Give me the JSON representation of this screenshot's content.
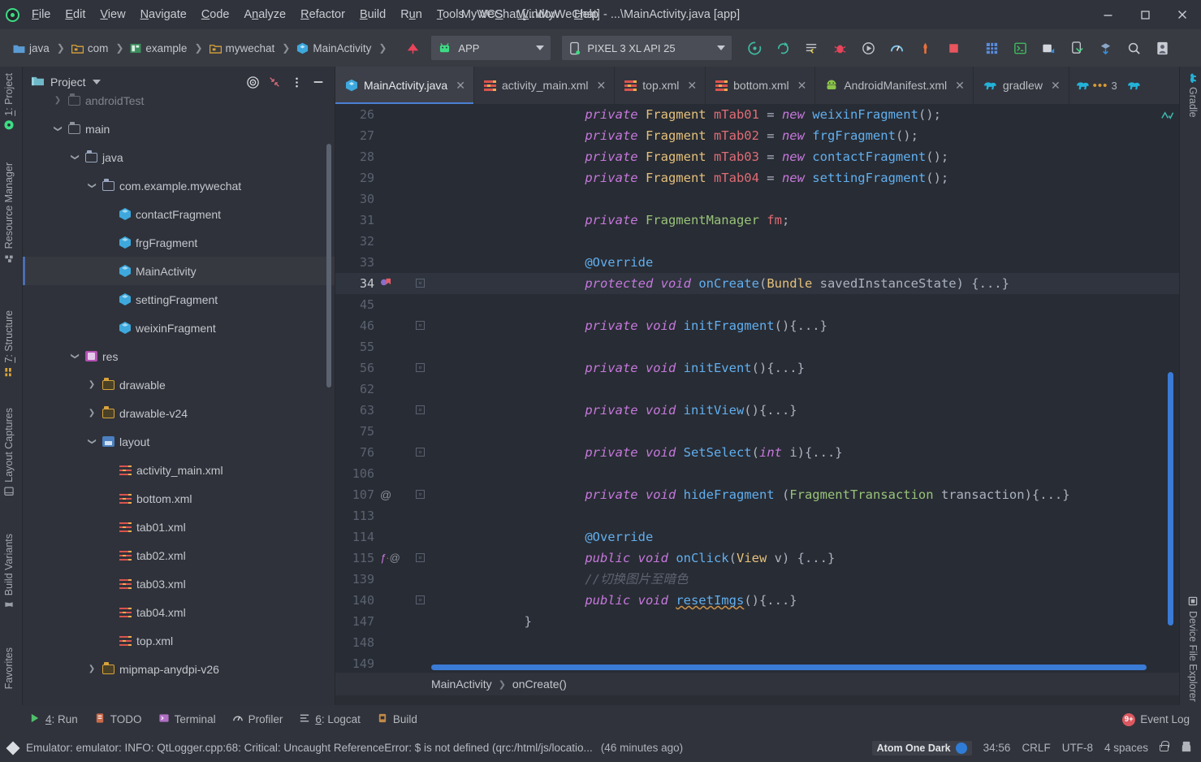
{
  "window": {
    "title": "MyWeChat [...\\MyWeChat] - ...\\MainActivity.java [app]",
    "minimize": "—",
    "maximize": "☐",
    "close": "✕"
  },
  "menu": {
    "items": [
      "File",
      "Edit",
      "View",
      "Navigate",
      "Code",
      "Analyze",
      "Refactor",
      "Build",
      "Run",
      "Tools",
      "VCS",
      "Window",
      "Help"
    ]
  },
  "navbar": {
    "breadcrumbs": [
      {
        "label": "java",
        "icon": "folder-blue-icon"
      },
      {
        "label": "com",
        "icon": "folder-yellow-icon"
      },
      {
        "label": "example",
        "icon": "module-green-icon"
      },
      {
        "label": "mywechat",
        "icon": "folder-yellow-icon"
      },
      {
        "label": "MainActivity",
        "icon": "java-class-icon"
      }
    ],
    "run_config": "APP",
    "device": "PIXEL 3 XL API 25",
    "toolbuttons": [
      "run-icon",
      "debug-rerun-icon",
      "apply-changes-icon",
      "debug-bug-icon",
      "run-with-coverage-icon",
      "profiler-icon",
      "attach-debugger-icon",
      "stop-icon",
      "layout-inspector-icon",
      "terminal-icon",
      "avd-manager-icon",
      "sdk-device-icon",
      "sdk-manager-icon",
      "search-icon",
      "user-avatar-icon"
    ]
  },
  "left_strip": {
    "items": [
      {
        "label": "1: Project",
        "mnemonic": "1",
        "icon": "project-icon"
      },
      {
        "label": "Resource Manager",
        "icon": "resource-manager-icon"
      },
      {
        "label": "7: Structure",
        "mnemonic": "7",
        "icon": "structure-icon"
      },
      {
        "label": "Layout Captures",
        "icon": "layout-captures-icon"
      },
      {
        "label": "Build Variants",
        "icon": "build-variants-icon"
      },
      {
        "label": "Favorites",
        "icon": "favorites-icon"
      }
    ]
  },
  "right_strip": {
    "items": [
      {
        "label": "Gradle",
        "icon": "gradle-elephant-icon"
      },
      {
        "label": "Device File Explorer",
        "icon": "device-file-explorer-icon"
      }
    ]
  },
  "project_panel": {
    "title": "Project",
    "actions": [
      "target-locate-icon",
      "collapse-all-icon",
      "options-menu-icon",
      "hide-icon"
    ],
    "tree": [
      {
        "label": "androidTest",
        "depth": 1,
        "state": "collapsed",
        "icon": "folder-grey-icon",
        "selected": false,
        "dim": true
      },
      {
        "label": "main",
        "depth": 1,
        "state": "expanded",
        "icon": "folder-grey-icon",
        "selected": false
      },
      {
        "label": "java",
        "depth": 2,
        "state": "expanded",
        "icon": "folder-blue-icon",
        "selected": false
      },
      {
        "label": "com.example.mywechat",
        "depth": 3,
        "state": "expanded",
        "icon": "folder-blue-icon",
        "selected": false
      },
      {
        "label": "contactFragment",
        "depth": 4,
        "state": "leaf",
        "icon": "java-class-icon",
        "selected": false
      },
      {
        "label": "frgFragment",
        "depth": 4,
        "state": "leaf",
        "icon": "java-class-icon",
        "selected": false
      },
      {
        "label": "MainActivity",
        "depth": 4,
        "state": "leaf",
        "icon": "java-class-icon",
        "selected": true
      },
      {
        "label": "settingFragment",
        "depth": 4,
        "state": "leaf",
        "icon": "java-class-icon",
        "selected": false
      },
      {
        "label": "weixinFragment",
        "depth": 4,
        "state": "leaf",
        "icon": "java-class-icon",
        "selected": false
      },
      {
        "label": "res",
        "depth": 2,
        "state": "expanded",
        "icon": "res-folder-icon",
        "selected": false
      },
      {
        "label": "drawable",
        "depth": 3,
        "state": "collapsed",
        "icon": "folder-yellow-icon",
        "selected": false
      },
      {
        "label": "drawable-v24",
        "depth": 3,
        "state": "collapsed",
        "icon": "folder-yellow-icon",
        "selected": false
      },
      {
        "label": "layout",
        "depth": 3,
        "state": "expanded",
        "icon": "layout-folder-icon",
        "selected": false
      },
      {
        "label": "activity_main.xml",
        "depth": 4,
        "state": "leaf",
        "icon": "xml-layout-icon",
        "selected": false
      },
      {
        "label": "bottom.xml",
        "depth": 4,
        "state": "leaf",
        "icon": "xml-layout-icon",
        "selected": false
      },
      {
        "label": "tab01.xml",
        "depth": 4,
        "state": "leaf",
        "icon": "xml-layout-icon",
        "selected": false
      },
      {
        "label": "tab02.xml",
        "depth": 4,
        "state": "leaf",
        "icon": "xml-layout-icon",
        "selected": false
      },
      {
        "label": "tab03.xml",
        "depth": 4,
        "state": "leaf",
        "icon": "xml-layout-icon",
        "selected": false
      },
      {
        "label": "tab04.xml",
        "depth": 4,
        "state": "leaf",
        "icon": "xml-layout-icon",
        "selected": false
      },
      {
        "label": "top.xml",
        "depth": 4,
        "state": "leaf",
        "icon": "xml-layout-icon",
        "selected": false
      },
      {
        "label": "mipmap-anydpi-v26",
        "depth": 3,
        "state": "collapsed",
        "icon": "folder-yellow-icon",
        "selected": false
      }
    ]
  },
  "editor_tabs": {
    "tabs": [
      {
        "label": "MainActivity.java",
        "icon": "java-class-icon",
        "active": true,
        "close": "✕"
      },
      {
        "label": "activity_main.xml",
        "icon": "xml-layout-icon",
        "active": false,
        "close": "✕"
      },
      {
        "label": "top.xml",
        "icon": "xml-layout-icon",
        "active": false,
        "close": "✕"
      },
      {
        "label": "bottom.xml",
        "icon": "xml-layout-icon",
        "active": false,
        "close": "✕"
      },
      {
        "label": "AndroidManifest.xml",
        "icon": "android-robot-icon",
        "active": false,
        "close": "✕"
      },
      {
        "label": "gradlew",
        "icon": "gradle-elephant-icon",
        "active": false,
        "close": "✕"
      }
    ],
    "overflow_count": "3",
    "overflow_icon": "more-tabs-icon"
  },
  "editor": {
    "current_line": 34,
    "lines": [
      {
        "num": "26",
        "indent": 2,
        "tokens": [
          {
            "t": "private ",
            "c": "kw"
          },
          {
            "t": "Fragment",
            "c": "typ"
          },
          {
            "t": " mTab01 ",
            "c": "var"
          },
          {
            "t": "= ",
            "c": "op"
          },
          {
            "t": "new ",
            "c": "kw"
          },
          {
            "t": "weixinFragment",
            "c": "fn"
          },
          {
            "t": "();",
            "c": "pl"
          }
        ]
      },
      {
        "num": "27",
        "indent": 2,
        "tokens": [
          {
            "t": "private ",
            "c": "kw"
          },
          {
            "t": "Fragment",
            "c": "typ"
          },
          {
            "t": " mTab02 ",
            "c": "var"
          },
          {
            "t": "= ",
            "c": "op"
          },
          {
            "t": "new ",
            "c": "kw"
          },
          {
            "t": "frgFragment",
            "c": "fn"
          },
          {
            "t": "();",
            "c": "pl"
          }
        ]
      },
      {
        "num": "28",
        "indent": 2,
        "tokens": [
          {
            "t": "private ",
            "c": "kw"
          },
          {
            "t": "Fragment",
            "c": "typ"
          },
          {
            "t": " mTab03 ",
            "c": "var"
          },
          {
            "t": "= ",
            "c": "op"
          },
          {
            "t": "new ",
            "c": "kw"
          },
          {
            "t": "contactFragment",
            "c": "fn"
          },
          {
            "t": "();",
            "c": "pl"
          }
        ]
      },
      {
        "num": "29",
        "indent": 2,
        "tokens": [
          {
            "t": "private ",
            "c": "kw"
          },
          {
            "t": "Fragment",
            "c": "typ"
          },
          {
            "t": " mTab04 ",
            "c": "var"
          },
          {
            "t": "= ",
            "c": "op"
          },
          {
            "t": "new ",
            "c": "kw"
          },
          {
            "t": "settingFragment",
            "c": "fn"
          },
          {
            "t": "();",
            "c": "pl"
          }
        ]
      },
      {
        "num": "30",
        "indent": 0,
        "tokens": []
      },
      {
        "num": "31",
        "indent": 2,
        "tokens": [
          {
            "t": "private ",
            "c": "kw"
          },
          {
            "t": "FragmentManager",
            "c": "fld"
          },
          {
            "t": " fm",
            "c": "var"
          },
          {
            "t": ";",
            "c": "pl"
          }
        ]
      },
      {
        "num": "32",
        "indent": 0,
        "tokens": []
      },
      {
        "num": "33",
        "indent": 2,
        "tokens": [
          {
            "t": "@Override",
            "c": "ann"
          }
        ]
      },
      {
        "num": "34",
        "indent": 2,
        "gutter": "breakpoint-bookmark-icon",
        "fold": true,
        "current": true,
        "tokens": [
          {
            "t": "protected ",
            "c": "kw"
          },
          {
            "t": "void ",
            "c": "kw"
          },
          {
            "t": "onCreate",
            "c": "fn"
          },
          {
            "t": "(",
            "c": "pl"
          },
          {
            "t": "Bundle",
            "c": "typ"
          },
          {
            "t": " savedInstanceState",
            "c": "pl"
          },
          {
            "t": ") {...}",
            "c": "pl"
          }
        ]
      },
      {
        "num": "45",
        "indent": 0,
        "tokens": []
      },
      {
        "num": "46",
        "indent": 2,
        "fold": true,
        "tokens": [
          {
            "t": "private ",
            "c": "kw"
          },
          {
            "t": "void ",
            "c": "kw"
          },
          {
            "t": "initFragment",
            "c": "fn"
          },
          {
            "t": "(){...}",
            "c": "pl"
          }
        ]
      },
      {
        "num": "55",
        "indent": 0,
        "tokens": []
      },
      {
        "num": "56",
        "indent": 2,
        "fold": true,
        "tokens": [
          {
            "t": "private ",
            "c": "kw"
          },
          {
            "t": "void ",
            "c": "kw"
          },
          {
            "t": "initEvent",
            "c": "fn"
          },
          {
            "t": "(){...}",
            "c": "pl"
          }
        ]
      },
      {
        "num": "62",
        "indent": 0,
        "tokens": []
      },
      {
        "num": "63",
        "indent": 2,
        "fold": true,
        "tokens": [
          {
            "t": "private ",
            "c": "kw"
          },
          {
            "t": "void ",
            "c": "kw"
          },
          {
            "t": "initView",
            "c": "fn"
          },
          {
            "t": "(){...}",
            "c": "pl"
          }
        ]
      },
      {
        "num": "75",
        "indent": 0,
        "tokens": []
      },
      {
        "num": "76",
        "indent": 2,
        "fold": true,
        "tokens": [
          {
            "t": "private ",
            "c": "kw"
          },
          {
            "t": "void ",
            "c": "kw"
          },
          {
            "t": "SetSelect",
            "c": "fn"
          },
          {
            "t": "(",
            "c": "pl"
          },
          {
            "t": "int ",
            "c": "kw"
          },
          {
            "t": "i){...}",
            "c": "pl"
          }
        ]
      },
      {
        "num": "106",
        "indent": 0,
        "tokens": []
      },
      {
        "num": "107",
        "indent": 2,
        "gutter": "override-marker-icon",
        "fold": true,
        "tokens": [
          {
            "t": "private ",
            "c": "kw"
          },
          {
            "t": "void ",
            "c": "kw"
          },
          {
            "t": "hideFragment",
            "c": "fn"
          },
          {
            "t": " (",
            "c": "pl"
          },
          {
            "t": "FragmentTransaction",
            "c": "fld"
          },
          {
            "t": " transaction",
            "c": "pl"
          },
          {
            "t": "){...}",
            "c": "pl"
          }
        ]
      },
      {
        "num": "113",
        "indent": 0,
        "tokens": []
      },
      {
        "num": "114",
        "indent": 2,
        "tokens": [
          {
            "t": "@Override",
            "c": "ann"
          }
        ]
      },
      {
        "num": "115",
        "indent": 2,
        "gutter": "implements-override-icon",
        "fold": true,
        "tokens": [
          {
            "t": "public ",
            "c": "kw"
          },
          {
            "t": "void ",
            "c": "kw"
          },
          {
            "t": "onClick",
            "c": "fn"
          },
          {
            "t": "(",
            "c": "pl"
          },
          {
            "t": "View",
            "c": "typ"
          },
          {
            "t": " v) {...}",
            "c": "pl"
          }
        ]
      },
      {
        "num": "139",
        "indent": 2,
        "tokens": [
          {
            "t": "//切换图片至暗色",
            "c": "cm"
          }
        ]
      },
      {
        "num": "140",
        "indent": 2,
        "fold": true,
        "tokens": [
          {
            "t": "public ",
            "c": "kw"
          },
          {
            "t": "void ",
            "c": "kw"
          },
          {
            "t": "resetImgs",
            "c": "fn squig"
          },
          {
            "t": "(){...}",
            "c": "pl"
          }
        ]
      },
      {
        "num": "147",
        "indent": 1,
        "tokens": [
          {
            "t": "}",
            "c": "pl"
          }
        ]
      },
      {
        "num": "148",
        "indent": 0,
        "tokens": []
      },
      {
        "num": "149",
        "indent": 0,
        "tokens": []
      }
    ],
    "inspection_icon": "inspections-ok-icon"
  },
  "breadcrumb": {
    "items": [
      "MainActivity",
      "onCreate()"
    ],
    "separator": "❯"
  },
  "bottom_toolwindows": {
    "items": [
      {
        "label": "4: Run",
        "mnemonic": "4",
        "icon": "run-icon"
      },
      {
        "label": "TODO",
        "icon": "todo-icon"
      },
      {
        "label": "Terminal",
        "icon": "terminal-icon"
      },
      {
        "label": "Profiler",
        "icon": "profiler-icon"
      },
      {
        "label": "6: Logcat",
        "mnemonic": "6",
        "icon": "logcat-icon"
      },
      {
        "label": "Build",
        "icon": "build-icon"
      }
    ],
    "event_log": {
      "label": "Event Log",
      "badge": "9+",
      "icon": "event-log-icon"
    }
  },
  "status_bar": {
    "message": "Emulator: emulator: INFO: QtLogger.cpp:68: Critical: Uncaught ReferenceError: $ is not defined (qrc:/html/js/locatio...",
    "message_time": "(46 minutes ago)",
    "theme": "Atom One Dark",
    "caret": "34:56",
    "line_separator": "CRLF",
    "encoding": "UTF-8",
    "indent": "4 spaces",
    "lock_icon": "unlocked-icon",
    "inspector_icon": "event-notifications-icon",
    "message_icon": "info-diamond-icon",
    "accent_color": "#2f7cd6"
  },
  "colors": {
    "editor_bg": "#282c34",
    "panel_bg": "#2f323a",
    "chrome_bg": "#30333b",
    "accent_blue": "#4b7fd4",
    "keyword": "#c678dd",
    "type": "#e5c07b",
    "function": "#61afef",
    "variable": "#e06c75",
    "field": "#98c379",
    "comment": "#5c6370"
  }
}
